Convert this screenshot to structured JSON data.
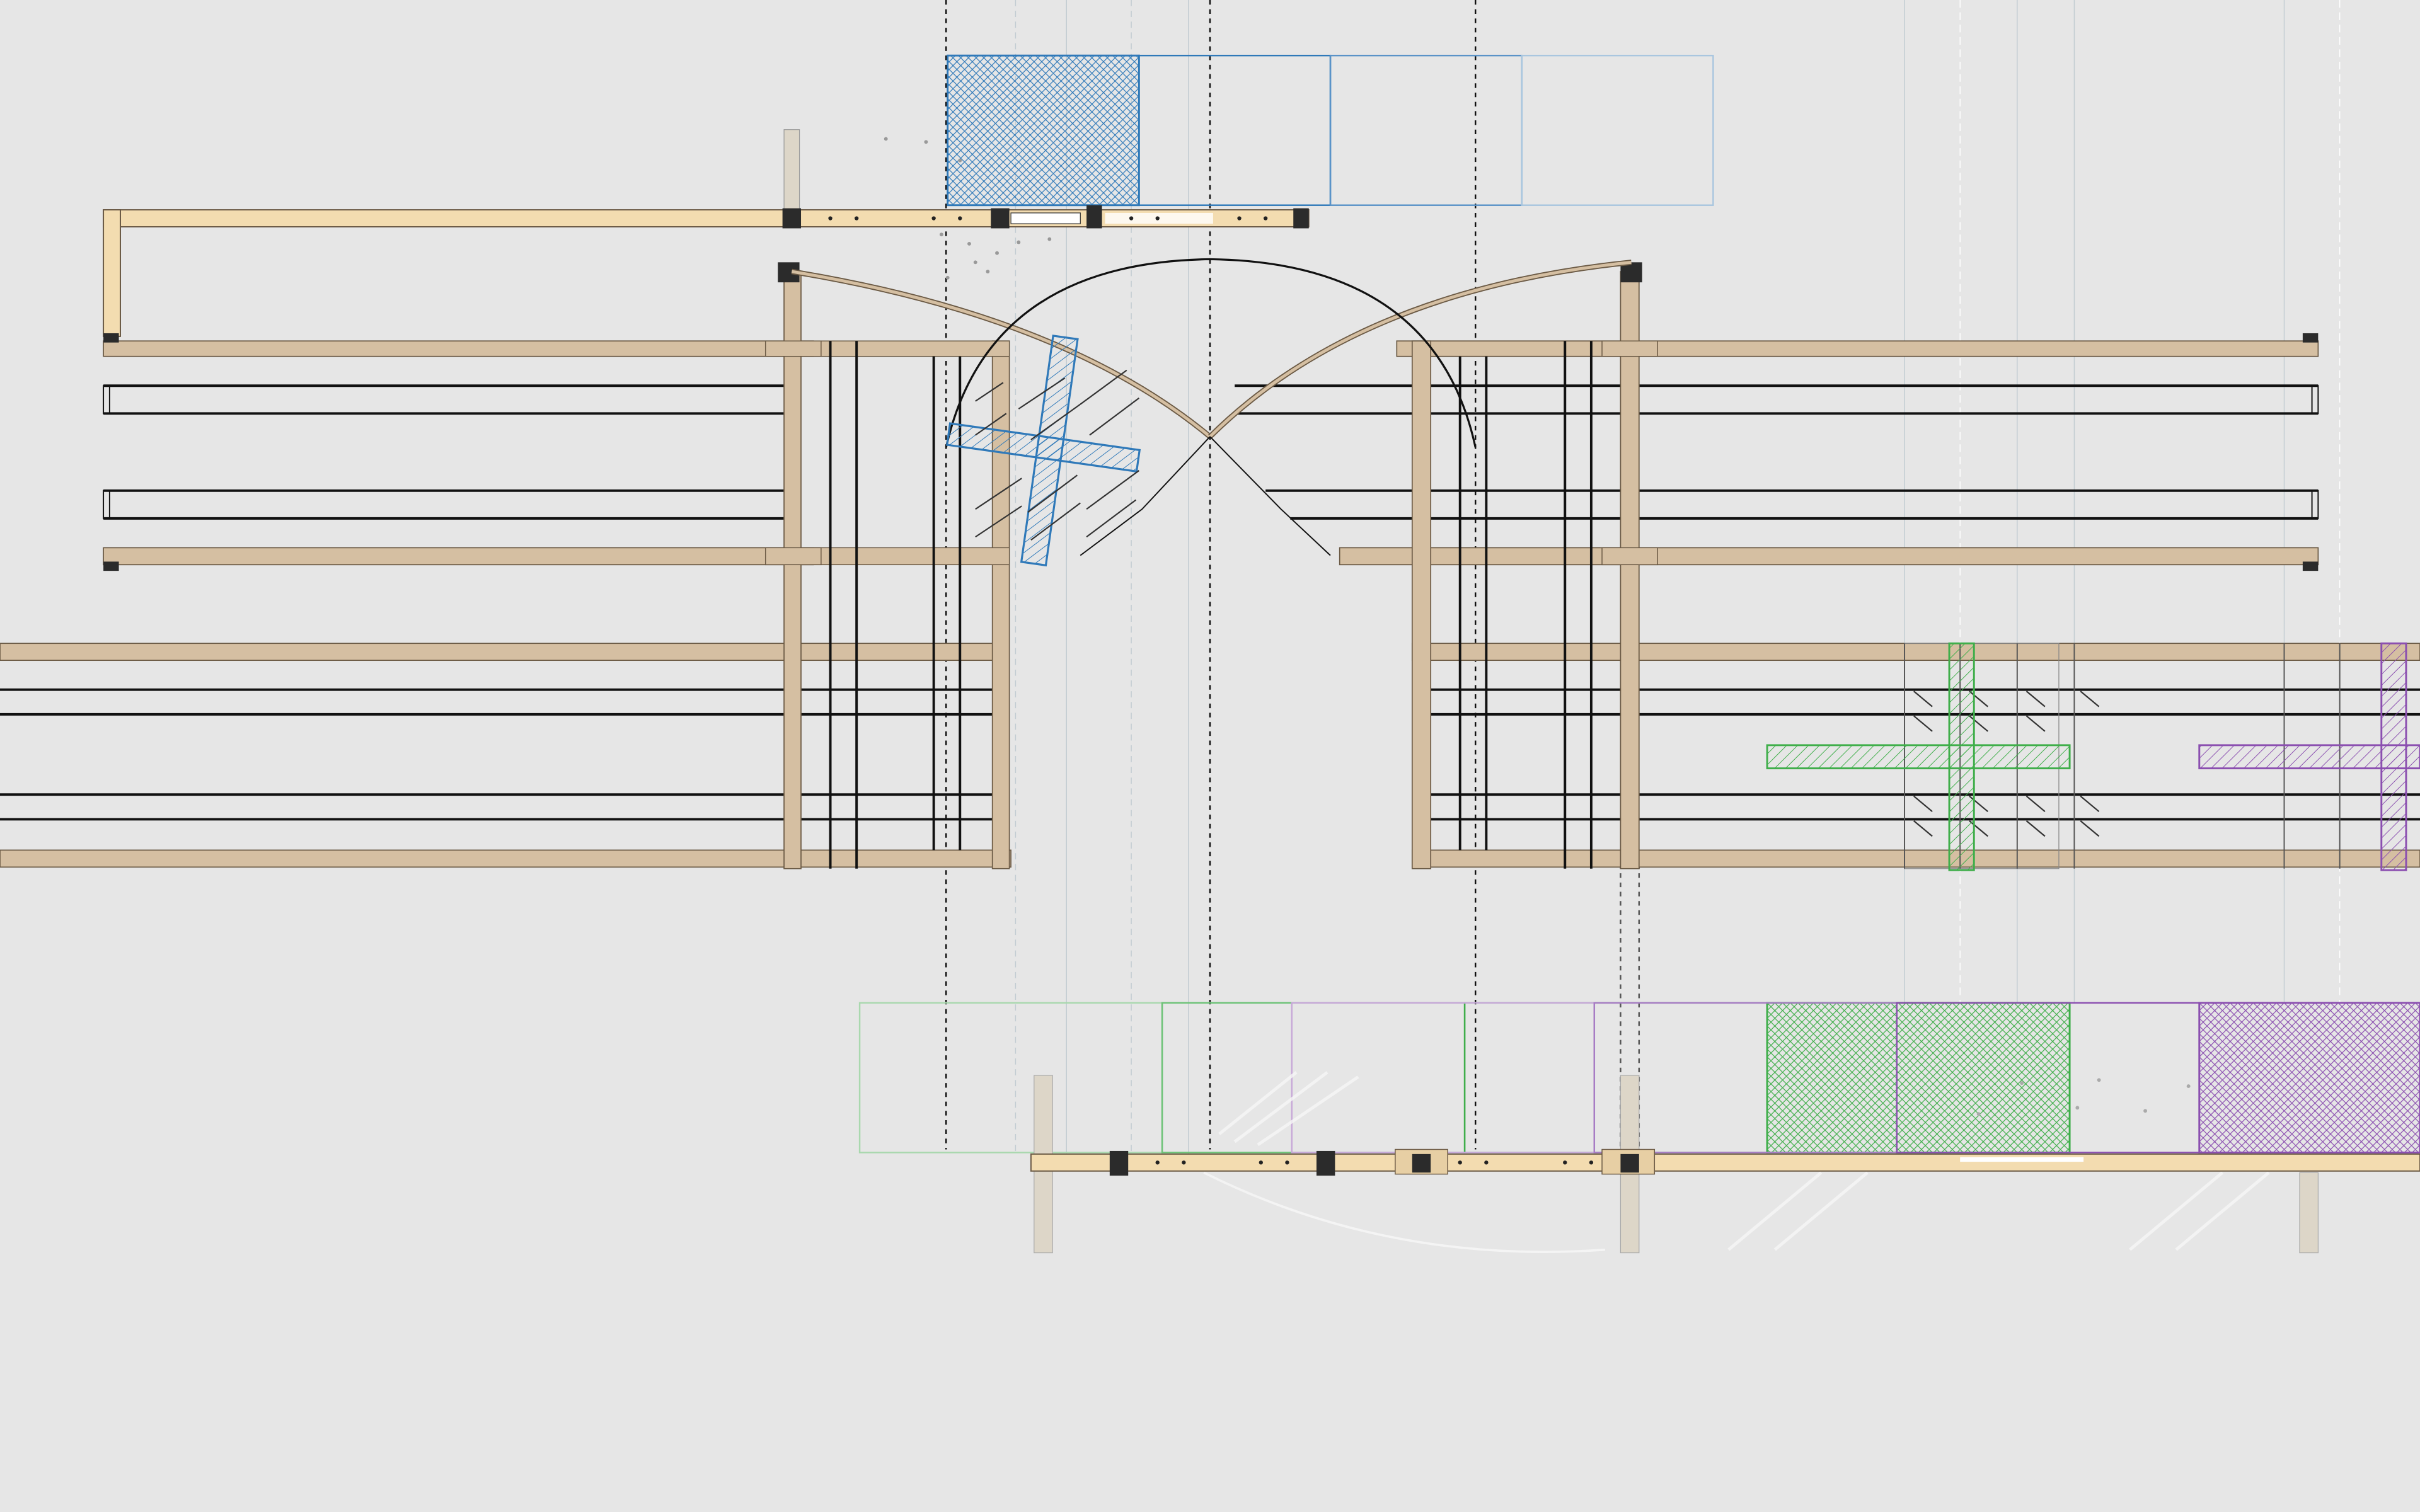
{
  "drawing": {
    "background": "#e6e6e6",
    "colors": {
      "timber": "#d5bfa2",
      "timber_light": "#f3dcb0",
      "timber_edge": "#6b5a45",
      "post": "#2b2b2b",
      "wire": "#111111",
      "blue": "#2f79b9",
      "green": "#3fae4a",
      "purple": "#8b4fb0",
      "guide": "#b8c6cf"
    }
  }
}
